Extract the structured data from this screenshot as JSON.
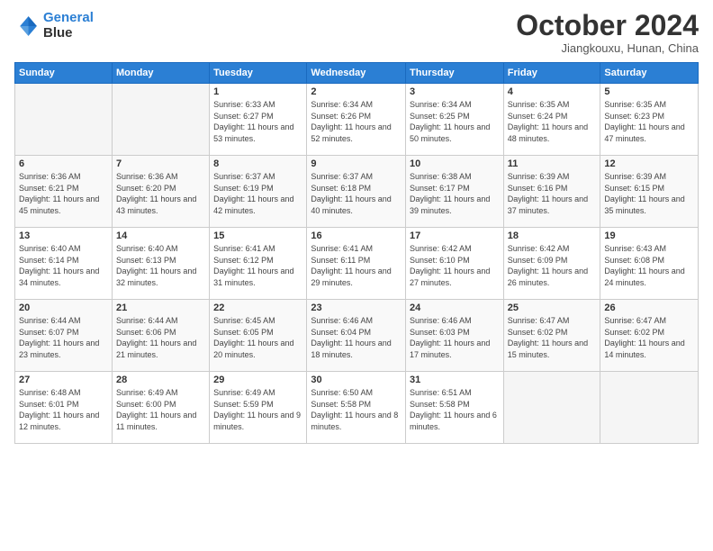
{
  "header": {
    "logo_line1": "General",
    "logo_line2": "Blue",
    "month": "October 2024",
    "location": "Jiangkouxu, Hunan, China"
  },
  "days_of_week": [
    "Sunday",
    "Monday",
    "Tuesday",
    "Wednesday",
    "Thursday",
    "Friday",
    "Saturday"
  ],
  "weeks": [
    [
      {
        "num": "",
        "detail": ""
      },
      {
        "num": "",
        "detail": ""
      },
      {
        "num": "1",
        "detail": "Sunrise: 6:33 AM\nSunset: 6:27 PM\nDaylight: 11 hours and 53 minutes."
      },
      {
        "num": "2",
        "detail": "Sunrise: 6:34 AM\nSunset: 6:26 PM\nDaylight: 11 hours and 52 minutes."
      },
      {
        "num": "3",
        "detail": "Sunrise: 6:34 AM\nSunset: 6:25 PM\nDaylight: 11 hours and 50 minutes."
      },
      {
        "num": "4",
        "detail": "Sunrise: 6:35 AM\nSunset: 6:24 PM\nDaylight: 11 hours and 48 minutes."
      },
      {
        "num": "5",
        "detail": "Sunrise: 6:35 AM\nSunset: 6:23 PM\nDaylight: 11 hours and 47 minutes."
      }
    ],
    [
      {
        "num": "6",
        "detail": "Sunrise: 6:36 AM\nSunset: 6:21 PM\nDaylight: 11 hours and 45 minutes."
      },
      {
        "num": "7",
        "detail": "Sunrise: 6:36 AM\nSunset: 6:20 PM\nDaylight: 11 hours and 43 minutes."
      },
      {
        "num": "8",
        "detail": "Sunrise: 6:37 AM\nSunset: 6:19 PM\nDaylight: 11 hours and 42 minutes."
      },
      {
        "num": "9",
        "detail": "Sunrise: 6:37 AM\nSunset: 6:18 PM\nDaylight: 11 hours and 40 minutes."
      },
      {
        "num": "10",
        "detail": "Sunrise: 6:38 AM\nSunset: 6:17 PM\nDaylight: 11 hours and 39 minutes."
      },
      {
        "num": "11",
        "detail": "Sunrise: 6:39 AM\nSunset: 6:16 PM\nDaylight: 11 hours and 37 minutes."
      },
      {
        "num": "12",
        "detail": "Sunrise: 6:39 AM\nSunset: 6:15 PM\nDaylight: 11 hours and 35 minutes."
      }
    ],
    [
      {
        "num": "13",
        "detail": "Sunrise: 6:40 AM\nSunset: 6:14 PM\nDaylight: 11 hours and 34 minutes."
      },
      {
        "num": "14",
        "detail": "Sunrise: 6:40 AM\nSunset: 6:13 PM\nDaylight: 11 hours and 32 minutes."
      },
      {
        "num": "15",
        "detail": "Sunrise: 6:41 AM\nSunset: 6:12 PM\nDaylight: 11 hours and 31 minutes."
      },
      {
        "num": "16",
        "detail": "Sunrise: 6:41 AM\nSunset: 6:11 PM\nDaylight: 11 hours and 29 minutes."
      },
      {
        "num": "17",
        "detail": "Sunrise: 6:42 AM\nSunset: 6:10 PM\nDaylight: 11 hours and 27 minutes."
      },
      {
        "num": "18",
        "detail": "Sunrise: 6:42 AM\nSunset: 6:09 PM\nDaylight: 11 hours and 26 minutes."
      },
      {
        "num": "19",
        "detail": "Sunrise: 6:43 AM\nSunset: 6:08 PM\nDaylight: 11 hours and 24 minutes."
      }
    ],
    [
      {
        "num": "20",
        "detail": "Sunrise: 6:44 AM\nSunset: 6:07 PM\nDaylight: 11 hours and 23 minutes."
      },
      {
        "num": "21",
        "detail": "Sunrise: 6:44 AM\nSunset: 6:06 PM\nDaylight: 11 hours and 21 minutes."
      },
      {
        "num": "22",
        "detail": "Sunrise: 6:45 AM\nSunset: 6:05 PM\nDaylight: 11 hours and 20 minutes."
      },
      {
        "num": "23",
        "detail": "Sunrise: 6:46 AM\nSunset: 6:04 PM\nDaylight: 11 hours and 18 minutes."
      },
      {
        "num": "24",
        "detail": "Sunrise: 6:46 AM\nSunset: 6:03 PM\nDaylight: 11 hours and 17 minutes."
      },
      {
        "num": "25",
        "detail": "Sunrise: 6:47 AM\nSunset: 6:02 PM\nDaylight: 11 hours and 15 minutes."
      },
      {
        "num": "26",
        "detail": "Sunrise: 6:47 AM\nSunset: 6:02 PM\nDaylight: 11 hours and 14 minutes."
      }
    ],
    [
      {
        "num": "27",
        "detail": "Sunrise: 6:48 AM\nSunset: 6:01 PM\nDaylight: 11 hours and 12 minutes."
      },
      {
        "num": "28",
        "detail": "Sunrise: 6:49 AM\nSunset: 6:00 PM\nDaylight: 11 hours and 11 minutes."
      },
      {
        "num": "29",
        "detail": "Sunrise: 6:49 AM\nSunset: 5:59 PM\nDaylight: 11 hours and 9 minutes."
      },
      {
        "num": "30",
        "detail": "Sunrise: 6:50 AM\nSunset: 5:58 PM\nDaylight: 11 hours and 8 minutes."
      },
      {
        "num": "31",
        "detail": "Sunrise: 6:51 AM\nSunset: 5:58 PM\nDaylight: 11 hours and 6 minutes."
      },
      {
        "num": "",
        "detail": ""
      },
      {
        "num": "",
        "detail": ""
      }
    ]
  ]
}
